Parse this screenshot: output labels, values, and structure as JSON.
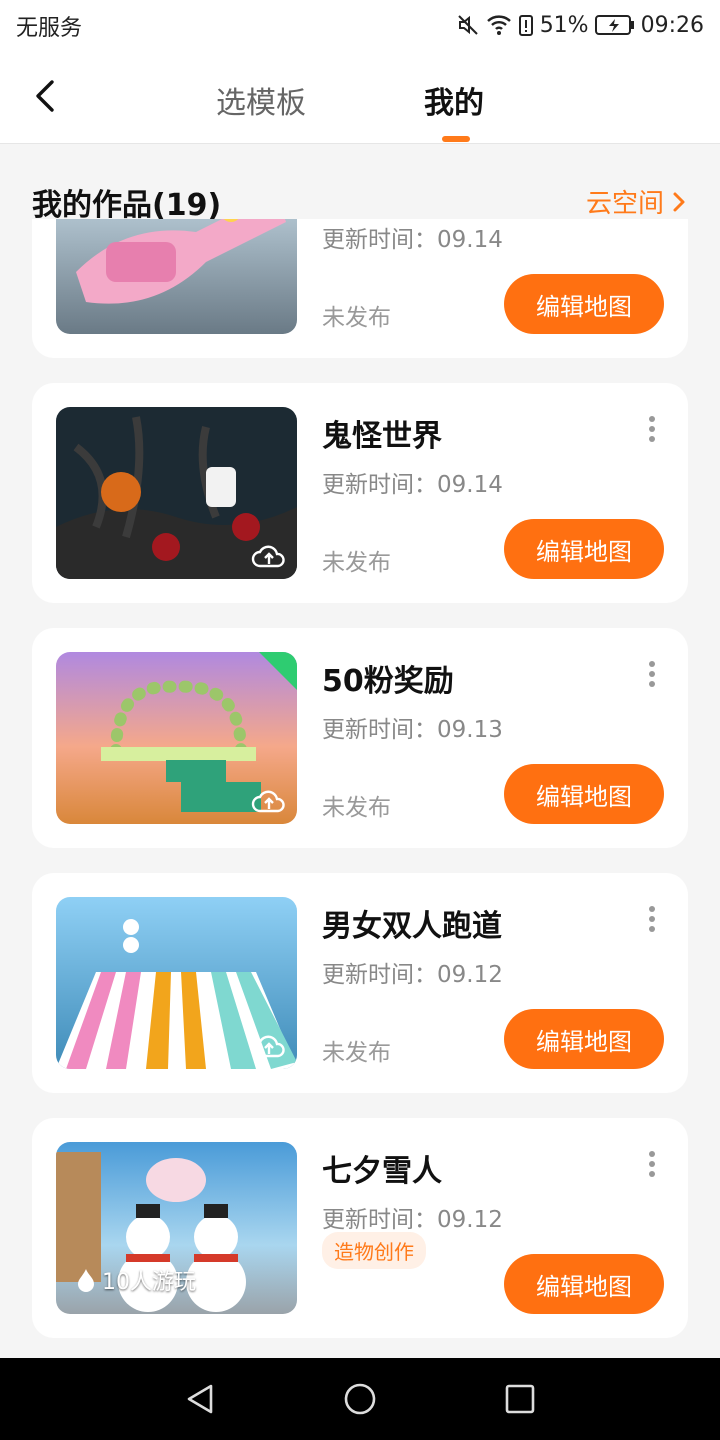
{
  "status_bar": {
    "carrier": "无服务",
    "battery": "51%",
    "time": "09:26"
  },
  "header": {
    "tabs": [
      {
        "label": "选模板",
        "active": false
      },
      {
        "label": "我的",
        "active": true
      }
    ],
    "accent": "#ff7a1a"
  },
  "section": {
    "title": "我的作品(19)",
    "cloud_link": "云空间"
  },
  "cards": [
    {
      "title": "",
      "updated": "更新时间：09.14",
      "status": "未发布",
      "button": "编辑地图",
      "thumb": "pink-castle"
    },
    {
      "title": "鬼怪世界",
      "updated": "更新时间：09.14",
      "status": "未发布",
      "button": "编辑地图",
      "thumb": "spooky-forest"
    },
    {
      "title": "50粉奖励",
      "updated": "更新时间：09.13",
      "status": "未发布",
      "button": "编辑地图",
      "thumb": "heart-arch"
    },
    {
      "title": "男女双人跑道",
      "updated": "更新时间：09.12",
      "status": "未发布",
      "button": "编辑地图",
      "thumb": "striped-track"
    },
    {
      "title": "七夕雪人",
      "updated": "更新时间：09.12",
      "tag": "造物创作",
      "plays": "10人游玩",
      "button": "编辑地图",
      "thumb": "snowmen"
    }
  ]
}
